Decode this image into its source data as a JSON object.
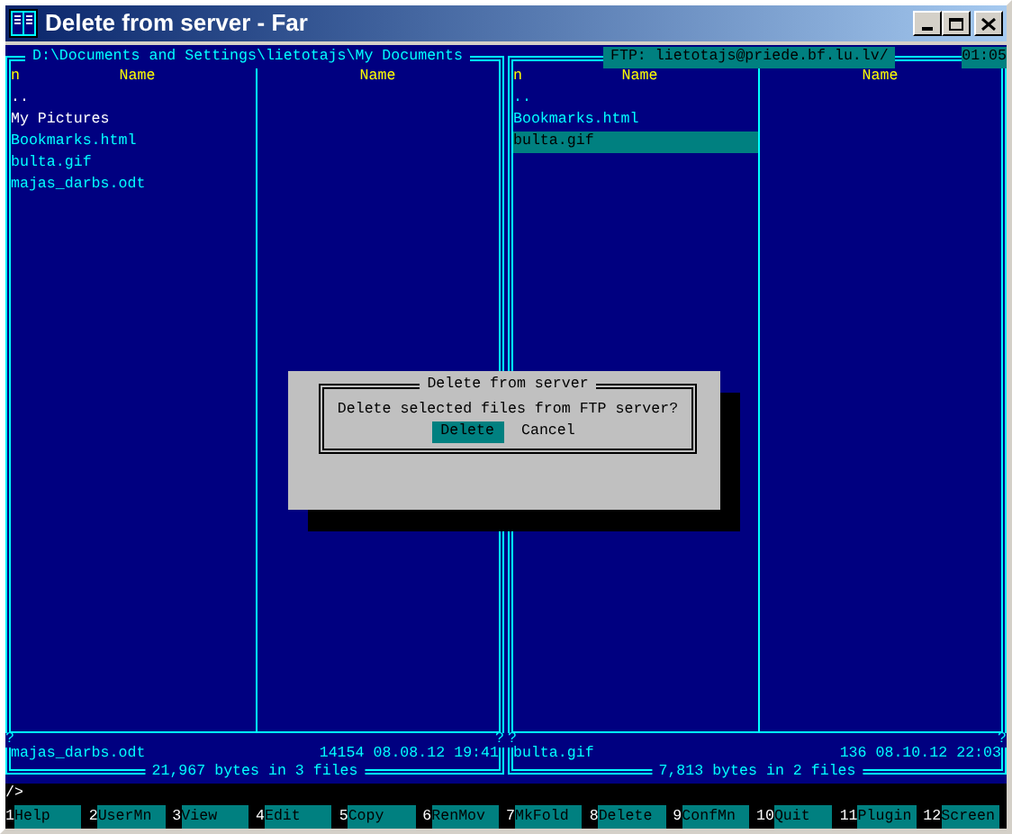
{
  "window": {
    "title": "Delete from server - Far"
  },
  "left_panel": {
    "path": "D:\\Documents and Settings\\lietotajs\\My Documents",
    "columns": [
      {
        "sort": "n",
        "name": "Name"
      },
      {
        "name": "Name"
      }
    ],
    "files": [
      {
        "name": "..",
        "kind": "folder",
        "selected": false
      },
      {
        "name": "My Pictures",
        "kind": "folder",
        "selected": false
      },
      {
        "name": "Bookmarks.html",
        "kind": "file",
        "selected": false
      },
      {
        "name": "bulta.gif",
        "kind": "file",
        "selected": false
      },
      {
        "name": "majas_darbs.odt",
        "kind": "file",
        "selected": false
      }
    ],
    "separator_marks": [
      "?",
      "?"
    ],
    "info": {
      "name": "majas_darbs.odt",
      "size": "14154",
      "date": "08.08.12",
      "time": "19:41"
    },
    "summary": "21,967 bytes in 3 files"
  },
  "right_panel": {
    "path": "FTP: lietotajs@priede.bf.lu.lv/",
    "clock": "01:05",
    "columns": [
      {
        "sort": "n",
        "name": "Name"
      },
      {
        "name": "Name"
      }
    ],
    "files": [
      {
        "name": "..",
        "kind": "file",
        "selected": false
      },
      {
        "name": "Bookmarks.html",
        "kind": "file",
        "selected": false
      },
      {
        "name": "bulta.gif",
        "kind": "file",
        "selected": true
      }
    ],
    "separator_marks": [
      "?",
      "?"
    ],
    "info": {
      "name": "bulta.gif",
      "size": "136",
      "date": "08.10.12",
      "time": "22:03"
    },
    "summary": "7,813 bytes in 2 files"
  },
  "dialog": {
    "title": "Delete from server",
    "message": "Delete selected files from FTP server?",
    "buttons": [
      {
        "label": "Delete",
        "selected": true
      },
      {
        "label": "Cancel",
        "selected": false
      }
    ]
  },
  "command_line": "/>",
  "function_keys": [
    {
      "num": "1",
      "label": "Help"
    },
    {
      "num": "2",
      "label": "UserMn"
    },
    {
      "num": "3",
      "label": "View"
    },
    {
      "num": "4",
      "label": "Edit"
    },
    {
      "num": "5",
      "label": "Copy"
    },
    {
      "num": "6",
      "label": "RenMov"
    },
    {
      "num": "7",
      "label": "MkFold"
    },
    {
      "num": "8",
      "label": "Delete"
    },
    {
      "num": "9",
      "label": "ConfMn"
    },
    {
      "num": "10",
      "label": "Quit"
    },
    {
      "num": "11",
      "label": "Plugin"
    },
    {
      "num": "12",
      "label": "Screen"
    }
  ]
}
